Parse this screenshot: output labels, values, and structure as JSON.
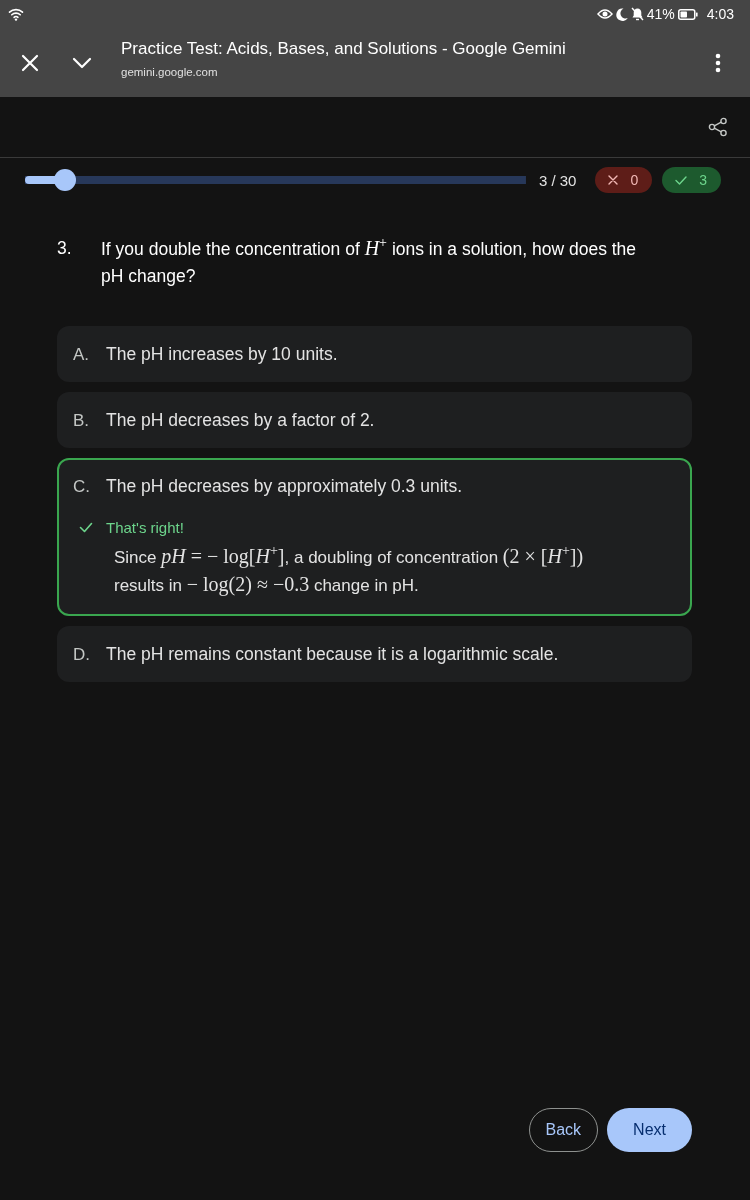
{
  "status_bar": {
    "battery": "41%",
    "time": "4:03"
  },
  "browser_bar": {
    "title": "Practice Test: Acids, Bases, and Solutions - Google Gemini",
    "url": "gemini.google.com"
  },
  "progress": {
    "level": 0.08,
    "counter": "3 / 30",
    "wrong_count": "0",
    "right_count": "3"
  },
  "question": {
    "number": "3.",
    "text": [
      {
        "kind": "text",
        "text": "If you double the concentration of "
      },
      {
        "kind": "math",
        "text": "*H*$^{+}$"
      },
      {
        "kind": "text",
        "text": " ions in a solution, how does the pH change?"
      }
    ]
  },
  "options": [
    {
      "letter": "A.",
      "text": "The pH increases by 10 units.",
      "selected": false
    },
    {
      "letter": "B.",
      "text": "The pH decreases by a factor of 2.",
      "selected": false
    },
    {
      "letter": "C.",
      "text": "The pH decreases by approximately 0.3 units.",
      "selected": true,
      "feedback": {
        "kind": "correct",
        "verdict": "That's right!",
        "explanation": [
          {
            "kind": "text",
            "text": "Since "
          },
          {
            "kind": "math",
            "text": "*pH* = − log[*H*$^{+}$]"
          },
          {
            "kind": "text",
            "text": ", a doubling of concentration "
          },
          {
            "kind": "math",
            "text": "(2 × [*H*$^{+}$])"
          },
          {
            "kind": "text",
            "text": " results in "
          },
          {
            "kind": "math",
            "text": "− log(2) ≈ −0.3"
          },
          {
            "kind": "text",
            "text": " change in pH."
          }
        ]
      }
    },
    {
      "letter": "D.",
      "text": "The pH remains constant because it is a logarithmic scale.",
      "selected": false
    }
  ],
  "buttons": [
    {
      "label": "Back",
      "kind": "outline"
    },
    {
      "label": "Next",
      "kind": "filled"
    }
  ]
}
